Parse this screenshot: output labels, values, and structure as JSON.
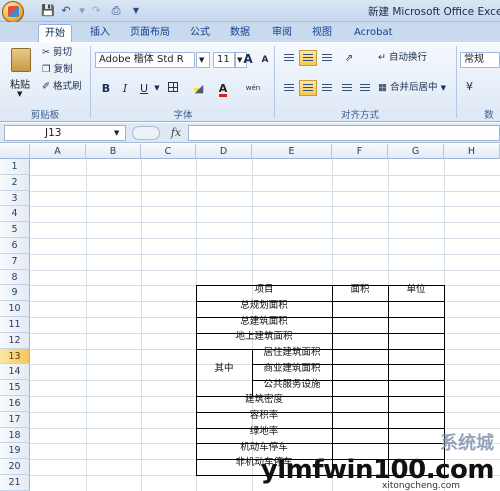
{
  "window": {
    "title": "新建 Microsoft Office Excel 工"
  },
  "qat": {
    "save_icon": "save-icon",
    "undo_icon": "undo-icon",
    "redo_icon": "redo-icon",
    "print_icon": "print-icon"
  },
  "tabs": [
    {
      "label": "开始",
      "active": true
    },
    {
      "label": "插入"
    },
    {
      "label": "页面布局"
    },
    {
      "label": "公式"
    },
    {
      "label": "数据"
    },
    {
      "label": "审阅"
    },
    {
      "label": "视图"
    },
    {
      "label": "Acrobat"
    }
  ],
  "ribbon": {
    "clipboard": {
      "paste": "粘贴",
      "cut": "剪切",
      "copy": "复制",
      "format_painter": "格式刷",
      "group": "剪贴板"
    },
    "font": {
      "name": "Adobe 楷体 Std R",
      "size": "11",
      "grow": "A",
      "shrink": "A",
      "bold": "B",
      "italic": "I",
      "underline": "U",
      "wen": "wén",
      "group": "字体"
    },
    "alignment": {
      "wrap": "自动换行",
      "merge": "合并后居中",
      "group": "对齐方式"
    },
    "number": {
      "format": "常规",
      "group": "数"
    }
  },
  "formula_bar": {
    "name_box": "J13",
    "fx": "fx",
    "content": ""
  },
  "sheet": {
    "columns": [
      "A",
      "B",
      "C",
      "D",
      "E",
      "F",
      "G",
      "H"
    ],
    "rows": [
      "1",
      "2",
      "3",
      "4",
      "5",
      "6",
      "7",
      "8",
      "9",
      "10",
      "11",
      "12",
      "13",
      "14",
      "15",
      "16",
      "17",
      "18",
      "19",
      "20",
      "21"
    ],
    "active_row": "13",
    "table": {
      "header_item": "项目",
      "header_area": "面积",
      "header_unit": "单位",
      "r10": "总规划面积",
      "r11": "总建筑面积",
      "r12": "地上建筑面积",
      "qizhong": "其中",
      "r13": "居住建筑面积",
      "r14": "商业建筑面积",
      "r15": "公共服务设施",
      "r16": "建筑密度",
      "r17": "容积率",
      "r18": "绿地率",
      "r19": "机动车停车",
      "r20": "非机动车停车"
    }
  },
  "watermark": {
    "main": "ylmfwin100.com",
    "sub": "xitongcheng.com",
    "cn": "系统城"
  }
}
